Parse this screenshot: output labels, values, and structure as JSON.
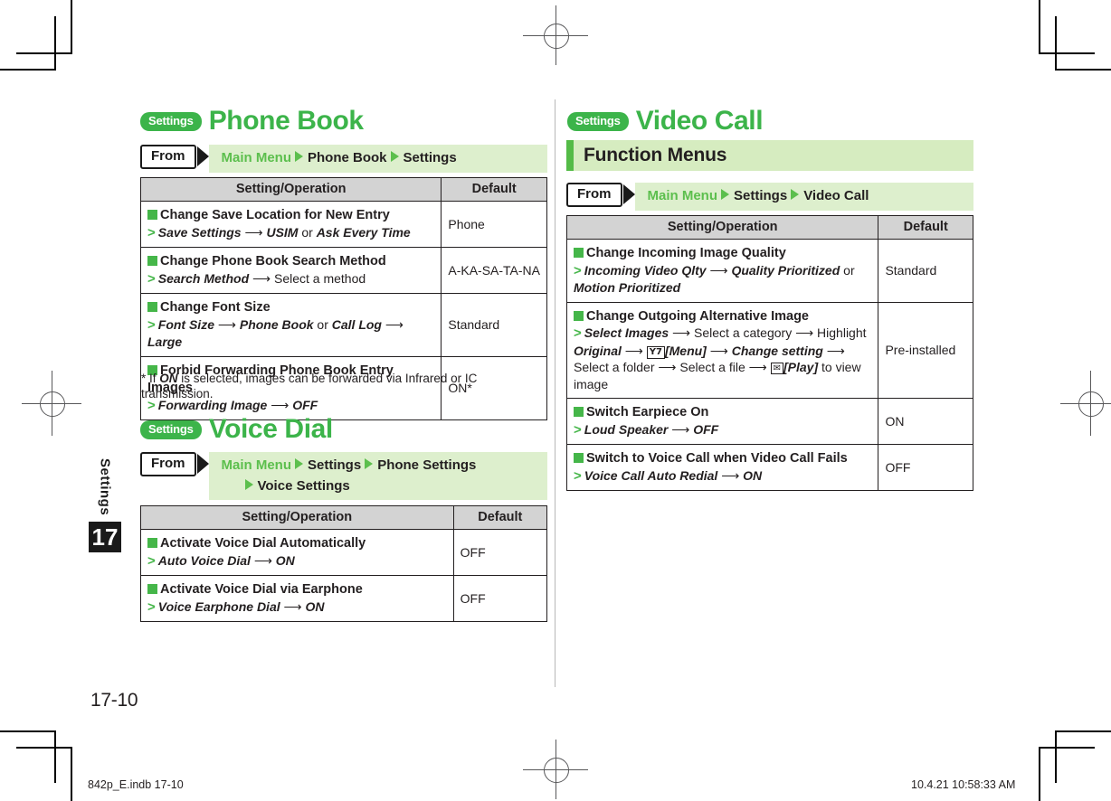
{
  "document": {
    "chapter_label": "Settings",
    "chapter_number": "17",
    "page_number": "17-10",
    "footer_left": "842p_E.indb   17-10",
    "footer_right": "10.4.21   10:58:33 AM"
  },
  "colors": {
    "brand_green": "#3cb44a",
    "bar_green": "#54bb47",
    "band_green": "#d6ecc0",
    "crumb_green": "#ddefcd",
    "marker_green": "#45b649",
    "header_gray": "#d3d3d3",
    "text_dark": "#231f20"
  },
  "left_column": {
    "sections": [
      {
        "pill": "Settings",
        "title": "Phone Book",
        "from": {
          "label": "From",
          "crumbs": [
            {
              "text": "Main Menu",
              "style": "green"
            },
            {
              "text": "Phone Book",
              "style": "dark"
            },
            {
              "text": "Settings",
              "style": "dark"
            }
          ]
        },
        "table": {
          "headers": [
            "Setting/Operation",
            "Default"
          ],
          "rows": [
            {
              "title": "Change Save Location for New Entry",
              "steps_html": "<span class=\"gt\">&gt;</span><span class=\"bi\">Save Settings</span> <span class=\"arr\">&#10230;</span> <span class=\"bi\">USIM</span> <span class=\"reg-txt\">or</span> <span class=\"bi\">Ask Every Time</span>",
              "default": "Phone"
            },
            {
              "title": "Change Phone Book Search Method",
              "steps_html": "<span class=\"gt\">&gt;</span><span class=\"bi\">Search Method</span> <span class=\"arr\">&#10230;</span> <span class=\"reg-txt\">Select a method</span>",
              "default": "A-KA-SA-TA-NA"
            },
            {
              "title": "Change Font Size",
              "steps_html": "<span class=\"gt\">&gt;</span><span class=\"bi\">Font Size</span> <span class=\"arr\">&#10230;</span> <span class=\"bi\">Phone Book</span> <span class=\"reg-txt\">or</span> <span class=\"bi\">Call Log</span> <span class=\"arr\">&#10230;</span> <span class=\"bi\">Large</span>",
              "default": "Standard"
            },
            {
              "title": "Forbid Forwarding Phone Book Entry Images",
              "steps_html": "<span class=\"gt\">&gt;</span><span class=\"bi\">Forwarding Image</span> <span class=\"arr\">&#10230;</span> <span class=\"bi\">OFF</span>",
              "default": "ON*"
            }
          ]
        },
        "footnote_html": "* If <span class=\"bi\">ON</span> is selected, images can be forwarded via Infrared or IC transmission."
      },
      {
        "pill": "Settings",
        "title": "Voice Dial",
        "from": {
          "label": "From",
          "crumbs": [
            {
              "text": "Main Menu",
              "style": "green"
            },
            {
              "text": "Settings",
              "style": "dark"
            },
            {
              "text": "Phone Settings",
              "style": "dark"
            },
            {
              "text": "Voice Settings",
              "style": "dark",
              "newline": true
            }
          ]
        },
        "table": {
          "headers": [
            "Setting/Operation",
            "Default"
          ],
          "rows": [
            {
              "title": "Activate Voice Dial Automatically",
              "steps_html": "<span class=\"gt\">&gt;</span><span class=\"bi\">Auto Voice Dial</span> <span class=\"arr\">&#10230;</span> <span class=\"bi\">ON</span>",
              "default": "OFF"
            },
            {
              "title": "Activate Voice Dial via Earphone",
              "steps_html": "<span class=\"gt\">&gt;</span><span class=\"bi\">Voice Earphone Dial</span> <span class=\"arr\">&#10230;</span> <span class=\"bi\">ON</span>",
              "default": "OFF"
            }
          ]
        }
      }
    ]
  },
  "right_column": {
    "section": {
      "pill": "Settings",
      "title": "Video Call",
      "band_title": "Function Menus",
      "from": {
        "label": "From",
        "crumbs": [
          {
            "text": "Main Menu",
            "style": "green"
          },
          {
            "text": "Settings",
            "style": "dark"
          },
          {
            "text": "Video Call",
            "style": "dark"
          }
        ]
      },
      "table": {
        "headers": [
          "Setting/Operation",
          "Default"
        ],
        "rows": [
          {
            "title": "Change Incoming Image Quality",
            "steps_html": "<span class=\"gt\">&gt;</span><span class=\"bi\">Incoming Video Qlty</span> <span class=\"arr\">&#10230;</span> <span class=\"bi\">Quality Prioritized</span> <span class=\"reg-txt\">or</span> <span class=\"bi\">Motion Prioritized</span>",
            "default": "Standard"
          },
          {
            "title": "Change Outgoing Alternative Image",
            "steps_html": "<span class=\"gt\">&gt;</span><span class=\"bi\">Select Images</span> <span class=\"arr\">&#10230;</span> <span class=\"reg-txt\">Select a category</span> <span class=\"arr\">&#10230;</span> <span class=\"reg-txt\">Highlight</span> <span class=\"bi\">Original</span> <span class=\"arr\">&#10230;</span> <span class=\"keybox\" data-name=\"menu-key-icon\">Y7</span><span class=\"bi\">[Menu]</span> <span class=\"arr\">&#10230;</span> <span class=\"bi\">Change setting</span> <span class=\"arr\">&#10230;</span> <span class=\"reg-txt\">Select a folder</span> <span class=\"arr\">&#10230;</span> <span class=\"reg-txt\">Select a file</span> <span class=\"arr\">&#10230;</span> <span class=\"keybox env\" data-name=\"envelope-key-icon\">&#9993;</span><span class=\"bi\">[Play]</span> <span class=\"reg-txt\">to view image</span>",
            "default": "Pre-installed"
          },
          {
            "title": "Switch Earpiece On",
            "steps_html": "<span class=\"gt\">&gt;</span><span class=\"bi\">Loud Speaker</span> <span class=\"arr\">&#10230;</span> <span class=\"bi\">OFF</span>",
            "default": "ON"
          },
          {
            "title": "Switch to Voice Call when Video Call Fails",
            "steps_html": "<span class=\"gt\">&gt;</span><span class=\"bi\">Voice Call Auto Redial</span> <span class=\"arr\">&#10230;</span> <span class=\"bi\">ON</span>",
            "default": "OFF"
          }
        ]
      }
    }
  }
}
